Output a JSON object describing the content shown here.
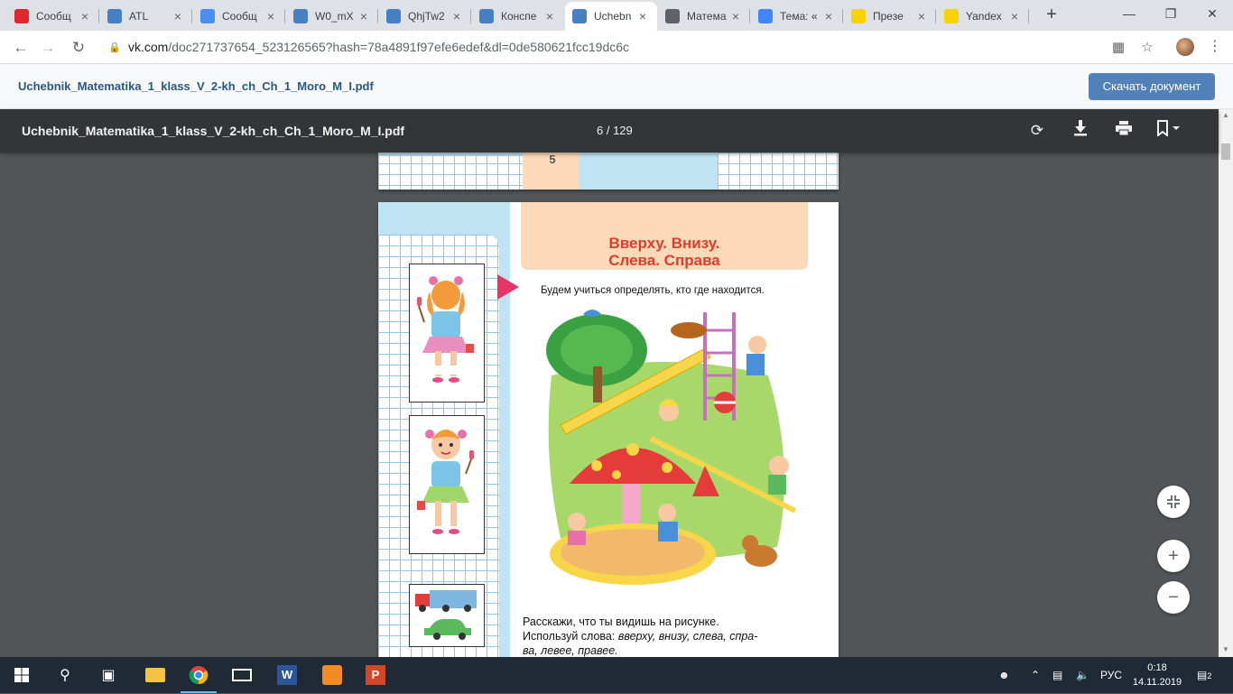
{
  "browser": {
    "tabs": [
      {
        "title": "Сообщ",
        "icon": "vk-message-icon",
        "color": "#e0282c"
      },
      {
        "title": "ATL",
        "icon": "video-icon",
        "color": "#4680c2"
      },
      {
        "title": "Сообщ",
        "icon": "chat-icon",
        "color": "#4a8ff0"
      },
      {
        "title": "W0_mX",
        "icon": "vk-icon",
        "color": "#4680c2"
      },
      {
        "title": "QhjTw2",
        "icon": "vk-icon",
        "color": "#4680c2"
      },
      {
        "title": "Конспе",
        "icon": "vk-icon",
        "color": "#4680c2"
      },
      {
        "title": "Uchebn",
        "icon": "vk-icon",
        "color": "#4680c2"
      },
      {
        "title": "Матема",
        "icon": "globe-icon",
        "color": "#5f6368"
      },
      {
        "title": "Тема: «",
        "icon": "google-icon",
        "color": "#4285f4"
      },
      {
        "title": "Презе",
        "icon": "yandex-icon",
        "color": "#f7d300"
      },
      {
        "title": "Yandex",
        "icon": "yandex-icon",
        "color": "#f7d300"
      }
    ],
    "active_tab_index": 6,
    "url_host": "vk.com",
    "url_path": "/doc271737654_523126565?hash=78a4891f97efe6edef&dl=0de580621fcc19dc6c"
  },
  "vk": {
    "doc_name": "Uchebnik_Matematika_1_klass_V_2-kh_ch_Ch_1_Moro_M_I.pdf",
    "download_label": "Скачать документ"
  },
  "pdf": {
    "file_name": "Uchebnik_Matematika_1_klass_V_2-kh_ch_Ch_1_Moro_M_I.pdf",
    "page_indicator": "6 / 129",
    "prev_page_number": "5",
    "heading_line1": "Вверху.  Внизу.",
    "heading_line2": "Слева.  Справа",
    "lead": "Будем  учиться  определять,  кто  где  находится.",
    "bottom_line1": "Расскажи,  что  ты  видишь  на  рисунке.",
    "bottom_line2_prefix": "Используй слова: ",
    "bottom_line2_words": "вверху, внизу, слева, спра-",
    "bottom_line3": "ва, левее, правее."
  },
  "taskbar": {
    "language": "РУС",
    "time": "0:18",
    "date": "14.11.2019",
    "notifications": "2"
  }
}
